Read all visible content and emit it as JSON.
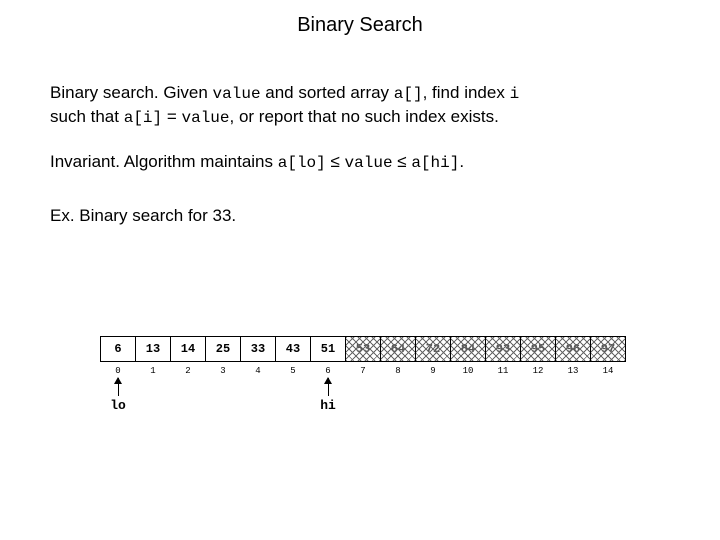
{
  "title": "Binary Search",
  "para1": {
    "lead": "Binary search.",
    "t1": "  Given ",
    "c1": "value",
    "t2": " and sorted array ",
    "c2": "a[]",
    "t3": ", find index ",
    "c3": "i",
    "t4": " such that ",
    "c4": "a[i]",
    "t5": " = ",
    "c5": "value",
    "t6": ", or report that no such index exists."
  },
  "para2": {
    "lead": "Invariant.",
    "t1": "  Algorithm maintains ",
    "c1": "a[lo]",
    "le1": " ≤ ",
    "c2": "value",
    "le2": " ≤ ",
    "c3": "a[hi]",
    "t2": "."
  },
  "para3": {
    "lead": "Ex.",
    "t1": "  Binary search for 33."
  },
  "array": {
    "values": [
      "6",
      "13",
      "14",
      "25",
      "33",
      "43",
      "51",
      "53",
      "64",
      "72",
      "84",
      "93",
      "95",
      "96",
      "97"
    ],
    "indices": [
      "0",
      "1",
      "2",
      "3",
      "4",
      "5",
      "6",
      "7",
      "8",
      "9",
      "10",
      "11",
      "12",
      "13",
      "14"
    ],
    "hatched_from": 7,
    "lo": {
      "index": 0,
      "label": "lo"
    },
    "hi": {
      "index": 6,
      "label": "hi"
    }
  }
}
